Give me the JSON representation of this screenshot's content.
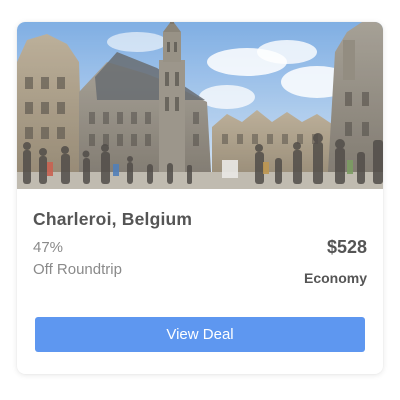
{
  "deal": {
    "destination": "Charleroi, Belgium",
    "discount_percent": "47%",
    "discount_label": "Off Roundtrip",
    "price": "$528",
    "cabin_class": "Economy",
    "button_label": "View Deal"
  },
  "colors": {
    "button": "#5e97f0",
    "title_text": "#555555",
    "muted_text": "#8a8a8a"
  }
}
